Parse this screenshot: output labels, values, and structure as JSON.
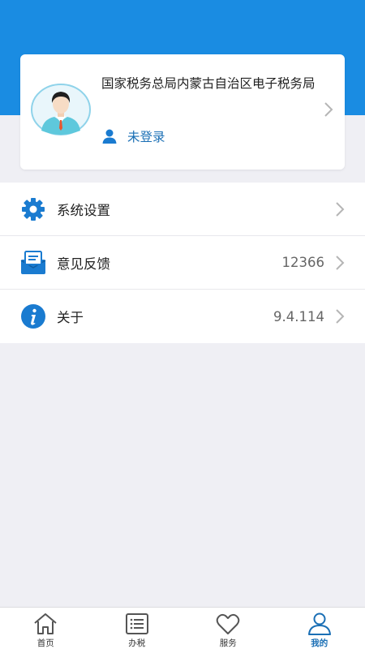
{
  "profile": {
    "org_name": "国家税务总局内蒙古自治区电子税务局",
    "login_status": "未登录"
  },
  "menu": {
    "items": [
      {
        "label": "系统设置",
        "value": "",
        "icon": "gear-icon"
      },
      {
        "label": "意见反馈",
        "value": "12366",
        "icon": "feedback-icon"
      },
      {
        "label": "关于",
        "value": "9.4.114",
        "icon": "info-icon"
      }
    ]
  },
  "tabbar": {
    "tabs": [
      {
        "label": "首页",
        "icon": "home-icon",
        "active": false
      },
      {
        "label": "办税",
        "icon": "list-icon",
        "active": false
      },
      {
        "label": "服务",
        "icon": "heart-icon",
        "active": false
      },
      {
        "label": "我的",
        "icon": "user-icon",
        "active": true
      }
    ]
  },
  "colors": {
    "header": "#1a8ce2",
    "accent": "#1a6fb5",
    "background": "#efeff4"
  }
}
